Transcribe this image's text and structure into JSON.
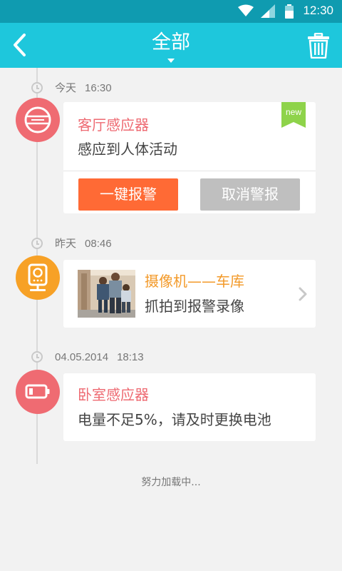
{
  "status_bar": {
    "time": "12:30",
    "icons": [
      "wifi-icon",
      "signal-icon",
      "battery-icon"
    ]
  },
  "header": {
    "title": "全部",
    "back_icon": "back-arrow-icon",
    "delete_icon": "trash-icon",
    "color": "#1ec7dc"
  },
  "events": [
    {
      "day": "今天",
      "time": "16:30",
      "icon": "smoke-sensor-icon",
      "badge_color": "#ef6b72",
      "title": "客厅感应器",
      "description": "感应到人体活动",
      "new_label": "new",
      "actions": {
        "alarm_label": "一键报警",
        "cancel_label": "取消警报"
      }
    },
    {
      "day": "昨天",
      "time": "08:46",
      "icon": "camera-icon",
      "badge_color": "#f7a126",
      "title": "摄像机——车库",
      "description": "抓拍到报警录像",
      "thumbnail": "snapshot-photo"
    },
    {
      "day": "04.05.2014",
      "time": "18:13",
      "icon": "low-battery-icon",
      "badge_color": "#ef6b72",
      "title": "卧室感应器",
      "description": "电量不足5%，请及时更换电池"
    }
  ],
  "footer": {
    "loading_text": "努力加载中..."
  }
}
